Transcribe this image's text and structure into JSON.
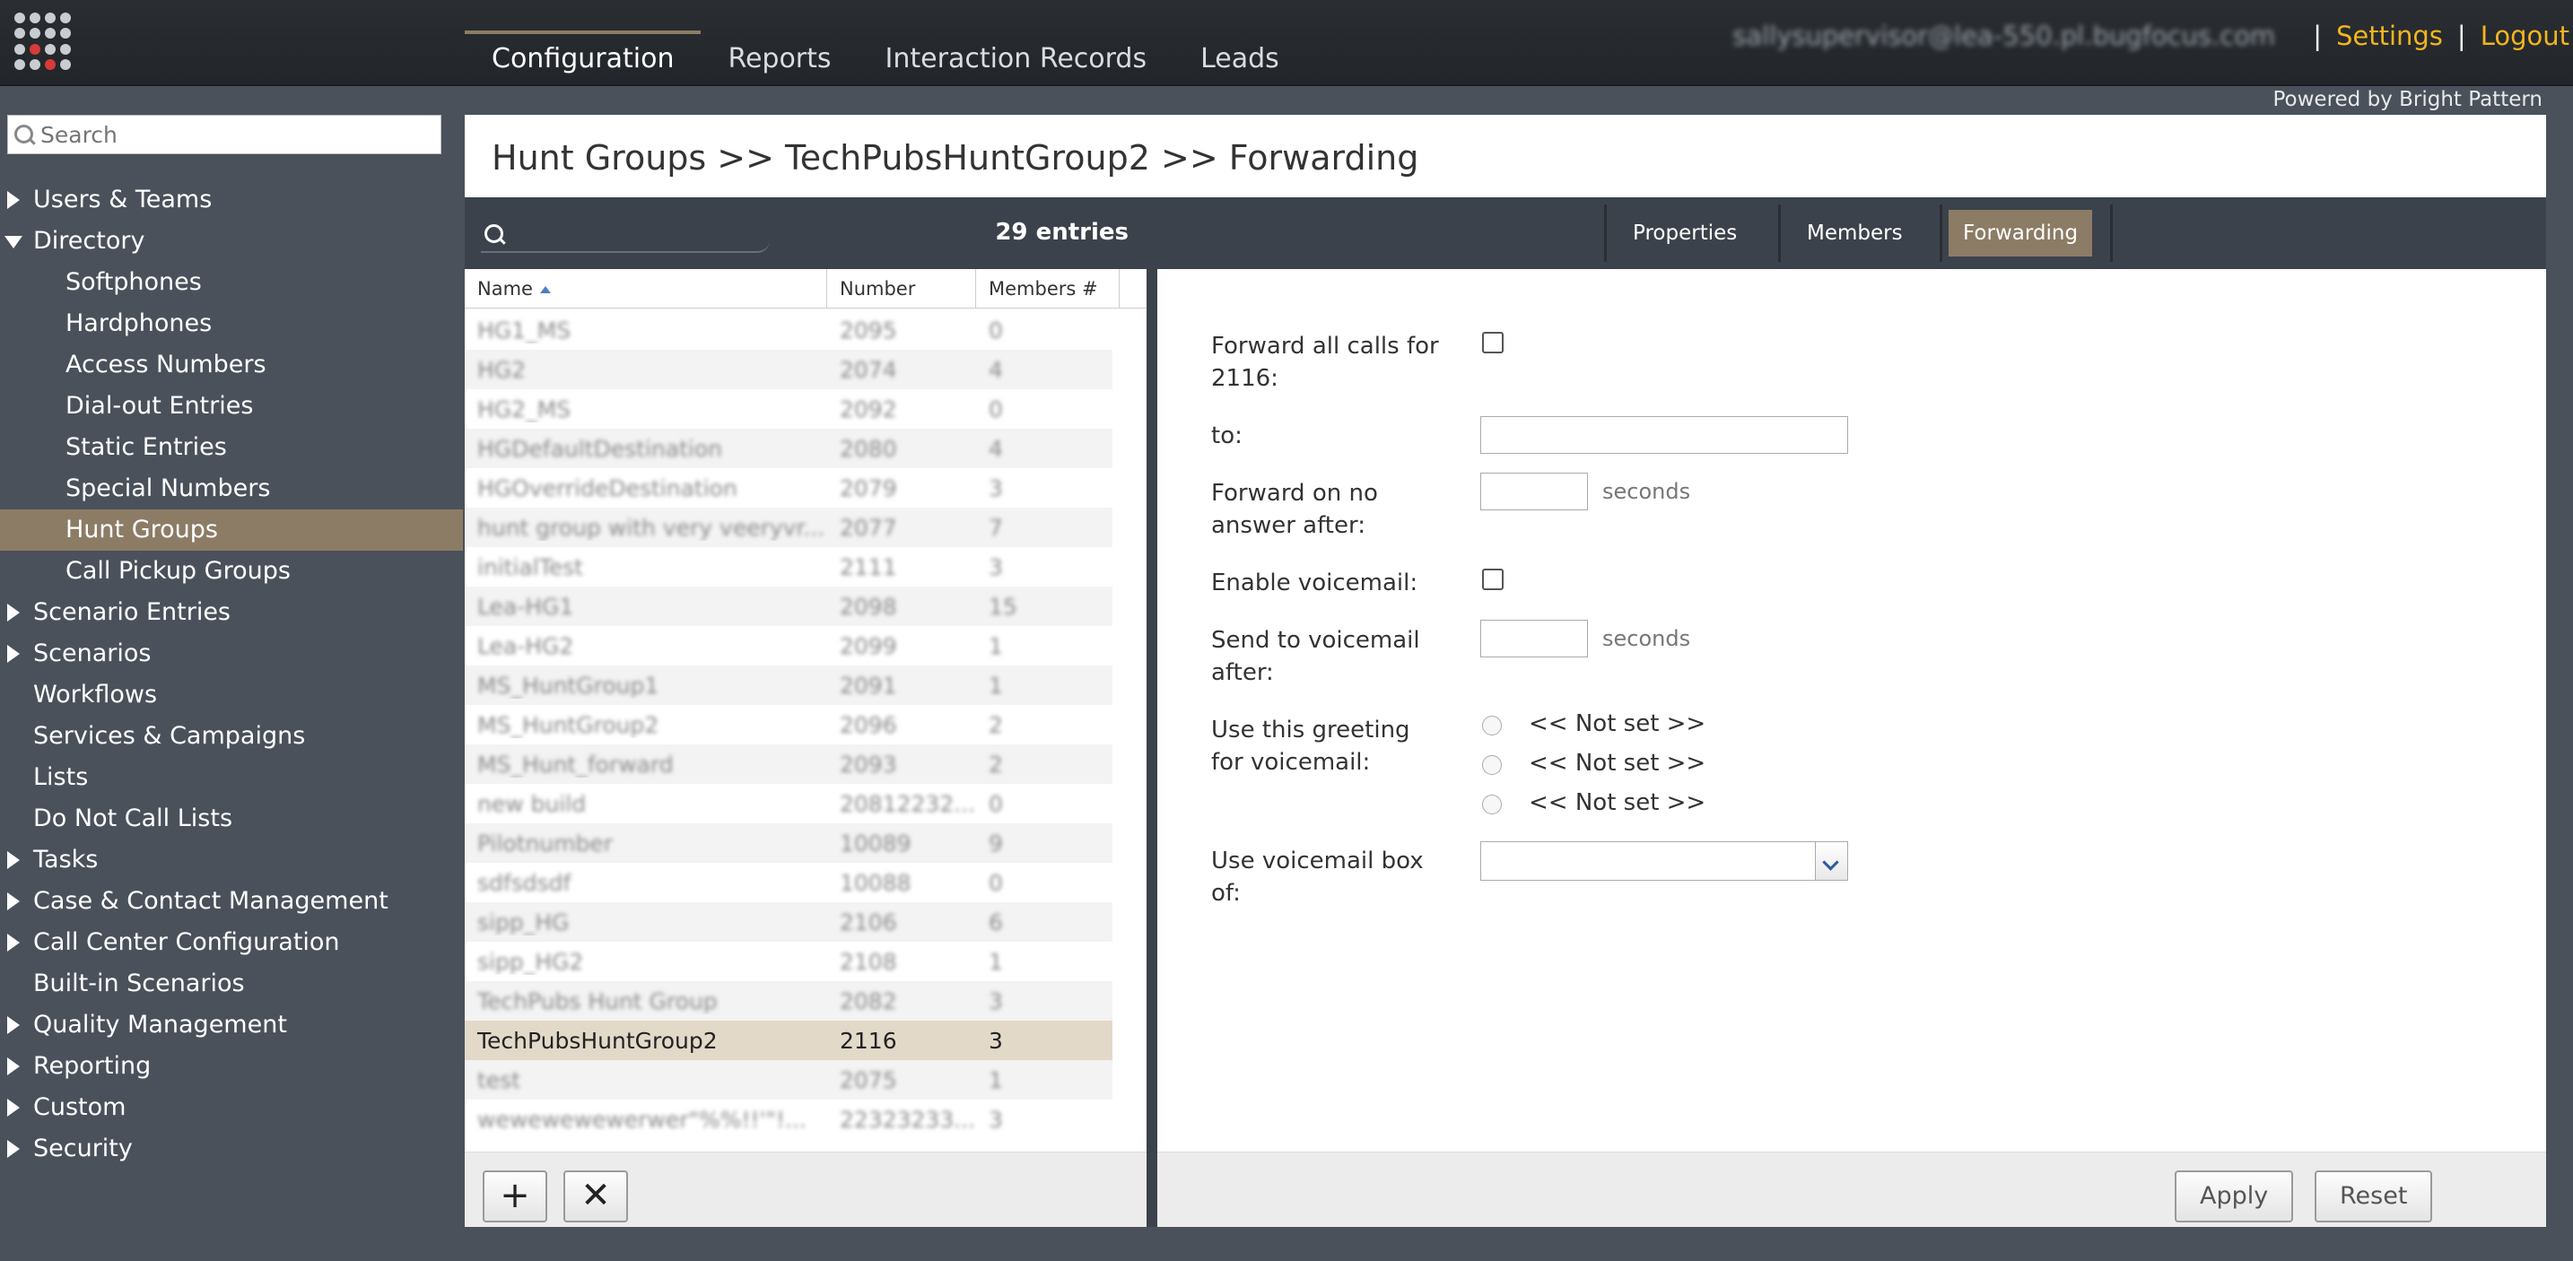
{
  "header": {
    "nav": [
      "Configuration",
      "Reports",
      "Interaction Records",
      "Leads"
    ],
    "active_nav": "Configuration",
    "user_email": "sallysupervisor@lea-550.pl.bugfocus.com",
    "separator": "|",
    "settings": "Settings",
    "logout": "Logout",
    "powered_by": "Powered by Bright Pattern",
    "link_color": "#f2b51f"
  },
  "sidebar": {
    "search_placeholder": "Search",
    "items": [
      {
        "label": "Users & Teams",
        "level": 0,
        "arrow": "right"
      },
      {
        "label": "Directory",
        "level": 0,
        "arrow": "down"
      },
      {
        "label": "Softphones",
        "level": 1
      },
      {
        "label": "Hardphones",
        "level": 1
      },
      {
        "label": "Access Numbers",
        "level": 1
      },
      {
        "label": "Dial-out Entries",
        "level": 1
      },
      {
        "label": "Static Entries",
        "level": 1
      },
      {
        "label": "Special Numbers",
        "level": 1
      },
      {
        "label": "Hunt Groups",
        "level": 1,
        "selected": true
      },
      {
        "label": "Call Pickup Groups",
        "level": 1
      },
      {
        "label": "Scenario Entries",
        "level": 0,
        "arrow": "right"
      },
      {
        "label": "Scenarios",
        "level": 0,
        "arrow": "right"
      },
      {
        "label": "Workflows",
        "level": 0
      },
      {
        "label": "Services & Campaigns",
        "level": 0
      },
      {
        "label": "Lists",
        "level": 0
      },
      {
        "label": "Do Not Call Lists",
        "level": 0
      },
      {
        "label": "Tasks",
        "level": 0,
        "arrow": "right"
      },
      {
        "label": "Case & Contact Management",
        "level": 0,
        "arrow": "right"
      },
      {
        "label": "Call Center Configuration",
        "level": 0,
        "arrow": "right"
      },
      {
        "label": "Built-in Scenarios",
        "level": 0
      },
      {
        "label": "Quality Management",
        "level": 0,
        "arrow": "right"
      },
      {
        "label": "Reporting",
        "level": 0,
        "arrow": "right"
      },
      {
        "label": "Custom",
        "level": 0,
        "arrow": "right"
      },
      {
        "label": "Security",
        "level": 0,
        "arrow": "right"
      }
    ],
    "selected_color": "#8c7c66"
  },
  "main": {
    "breadcrumb": "Hunt Groups >> TechPubsHuntGroup2 >> Forwarding"
  },
  "list": {
    "entries": "29 entries",
    "columns": [
      "Name",
      "Number",
      "Members #"
    ],
    "rows": [
      [
        "HG1_MS",
        "2095",
        "0"
      ],
      [
        "HG2",
        "2074",
        "4"
      ],
      [
        "HG2_MS",
        "2092",
        "0"
      ],
      [
        "HGDefaultDestination",
        "2080",
        "4"
      ],
      [
        "HGOverrideDestination",
        "2079",
        "3"
      ],
      [
        "hunt group with very veeryvr...",
        "2077",
        "7"
      ],
      [
        "initialTest",
        "2111",
        "3"
      ],
      [
        "Lea-HG1",
        "2098",
        "15"
      ],
      [
        "Lea-HG2",
        "2099",
        "1"
      ],
      [
        "MS_HuntGroup1",
        "2091",
        "1"
      ],
      [
        "MS_HuntGroup2",
        "2096",
        "2"
      ],
      [
        "MS_Hunt_forward",
        "2093",
        "2"
      ],
      [
        "new build",
        "20812232...",
        "0"
      ],
      [
        "Pilotnumber",
        "10089",
        "9"
      ],
      [
        "sdfsdsdf",
        "10088",
        "0"
      ],
      [
        "sipp_HG",
        "2106",
        "6"
      ],
      [
        "sipp_HG2",
        "2108",
        "1"
      ],
      [
        "TechPubs Hunt Group",
        "2082",
        "3"
      ],
      [
        "TechPubsHuntGroup2",
        "2116",
        "3"
      ],
      [
        "test",
        "2075",
        "1"
      ],
      [
        "wewewewewerwer\"%%!!'\"!...",
        "22323233...",
        "3"
      ]
    ],
    "selected_index": 18,
    "add_glyph": "+",
    "delete_glyph": "✕"
  },
  "tabs": [
    "Properties",
    "Members",
    "Forwarding"
  ],
  "active_tab": "Forwarding",
  "form": {
    "forward_all_label": "Forward all calls for 2116:",
    "forward_all_checked": false,
    "to_label": "to:",
    "to_value": "",
    "no_answer_label": "Forward on no answer after:",
    "no_answer_value": "",
    "seconds": "seconds",
    "voicemail_label": "Enable voicemail:",
    "voicemail_checked": false,
    "send_vm_label": "Send to voicemail after:",
    "send_vm_value": "",
    "greeting_label": "Use this greeting for voicemail:",
    "greeting_options": [
      "<< Not set >>",
      "<< Not set >>",
      "<< Not set >>"
    ],
    "vm_box_label": "Use voicemail box of:",
    "vm_box_value": ""
  },
  "buttons": {
    "apply": "Apply",
    "reset": "Reset"
  }
}
